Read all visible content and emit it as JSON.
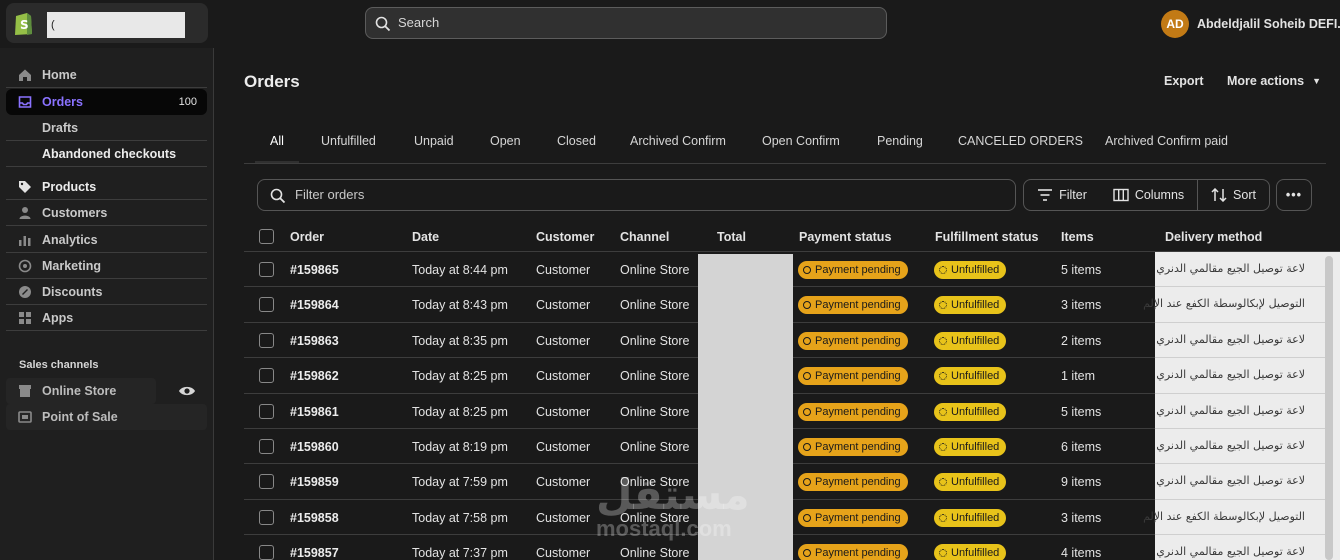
{
  "topbar": {
    "store_name": "(",
    "search_placeholder": "Search",
    "user_initials": "AD",
    "user_name": "Abdeldjalil Soheib DEFI..."
  },
  "sidebar": {
    "items": [
      {
        "label": "Home",
        "icon": "home-icon"
      },
      {
        "label": "Orders",
        "icon": "inbox-icon",
        "count": "100"
      },
      {
        "label": "Drafts"
      },
      {
        "label": "Abandoned checkouts"
      },
      {
        "label": "Products",
        "icon": "tag-icon"
      },
      {
        "label": "Customers",
        "icon": "person-icon"
      },
      {
        "label": "Analytics",
        "icon": "bar-chart-icon"
      },
      {
        "label": "Marketing",
        "icon": "target-icon"
      },
      {
        "label": "Discounts",
        "icon": "discount-icon"
      },
      {
        "label": "Apps",
        "icon": "apps-icon"
      }
    ],
    "sales_channels_label": "Sales channels",
    "channels": [
      {
        "label": "Online Store",
        "icon": "store-icon"
      },
      {
        "label": "Point of Sale",
        "icon": "pos-icon"
      }
    ]
  },
  "main": {
    "title": "Orders",
    "export_label": "Export",
    "more_actions_label": "More actions",
    "tabs": [
      "All",
      "Unfulfilled",
      "Unpaid",
      "Open",
      "Closed",
      "Archived Confirm",
      "Open Confirm",
      "Pending",
      "CANCELED ORDERS",
      "Archived Confirm paid"
    ],
    "filter_placeholder": "Filter orders",
    "filter_label": "Filter",
    "columns_label": "Columns",
    "sort_label": "Sort",
    "more_label": "•••"
  },
  "table": {
    "headers": [
      "Order",
      "Date",
      "Customer",
      "Channel",
      "Total",
      "Payment status",
      "Fulfillment status",
      "Items",
      "Delivery method"
    ],
    "rows": [
      {
        "order": "#159865",
        "date": "Today at 8:44 pm",
        "customer": "Customer",
        "channel": "Online Store",
        "payment": "Payment pending",
        "fulfillment": "Unfulfilled",
        "items": "5 items",
        "delivery": "لاعة توصيل الجيع مقالمي الدنري"
      },
      {
        "order": "#159864",
        "date": "Today at 8:43 pm",
        "customer": "Customer",
        "channel": "Online Store",
        "payment": "Payment pending",
        "fulfillment": "Unfulfilled",
        "items": "3 items",
        "delivery": "التوصيل لإبكالوسطة الكفع عند الإلم"
      },
      {
        "order": "#159863",
        "date": "Today at 8:35 pm",
        "customer": "Customer",
        "channel": "Online Store",
        "payment": "Payment pending",
        "fulfillment": "Unfulfilled",
        "items": "2 items",
        "delivery": "لاعة توصيل الجيع مقالمي الدنري"
      },
      {
        "order": "#159862",
        "date": "Today at 8:25 pm",
        "customer": "Customer",
        "channel": "Online Store",
        "payment": "Payment pending",
        "fulfillment": "Unfulfilled",
        "items": "1 item",
        "delivery": "لاعة توصيل الجيع مقالمي الدنري"
      },
      {
        "order": "#159861",
        "date": "Today at 8:25 pm",
        "customer": "Customer",
        "channel": "Online Store",
        "payment": "Payment pending",
        "fulfillment": "Unfulfilled",
        "items": "5 items",
        "delivery": "لاعة توصيل الجيع مقالمي الدنري"
      },
      {
        "order": "#159860",
        "date": "Today at 8:19 pm",
        "customer": "Customer",
        "channel": "Online Store",
        "payment": "Payment pending",
        "fulfillment": "Unfulfilled",
        "items": "6 items",
        "delivery": "لاعة توصيل الجيع مقالمي الدنري"
      },
      {
        "order": "#159859",
        "date": "Today at 7:59 pm",
        "customer": "Customer",
        "channel": "Online Store",
        "payment": "Payment pending",
        "fulfillment": "Unfulfilled",
        "items": "9 items",
        "delivery": "لاعة توصيل الجيع مقالمي الدنري"
      },
      {
        "order": "#159858",
        "date": "Today at 7:58 pm",
        "customer": "Customer",
        "channel": "Online Store",
        "payment": "Payment pending",
        "fulfillment": "Unfulfilled",
        "items": "3 items",
        "delivery": "التوصيل لإبكالوسطة الكفع عند الإلم"
      },
      {
        "order": "#159857",
        "date": "Today at 7:37 pm",
        "customer": "Customer",
        "channel": "Online Store",
        "payment": "Payment pending",
        "fulfillment": "Unfulfilled",
        "items": "4 items",
        "delivery": "لاعة توصيل الجيع مقالمي الدنري"
      }
    ]
  },
  "watermark": {
    "arabic": "مستقل",
    "latin": "mostaql.com"
  },
  "colors": {
    "accent": "#8a72ff",
    "payment_badge": "#e6a31a",
    "fulfillment_badge": "#e8c31a",
    "avatar": "#c27a15",
    "shopify_green": "#95bf47"
  }
}
